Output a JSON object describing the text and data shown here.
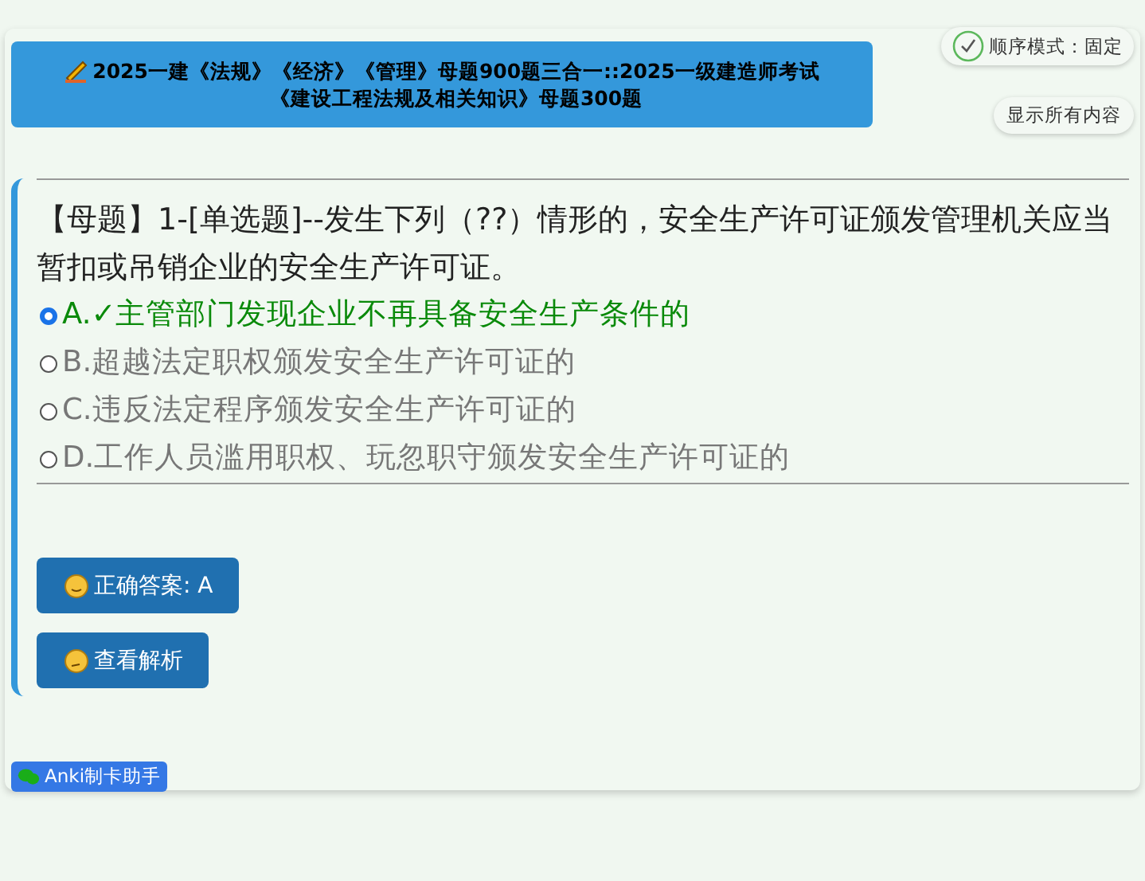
{
  "header": {
    "title_lines": [
      "2025一建《法规》《经济》《管理》母题900题三合一::2025一级建造师考试",
      "《建设工程法规及相关知识》母题300题"
    ]
  },
  "mode_badge": {
    "text": "顺序模式：固定",
    "checked": true
  },
  "show_all_button": "显示所有内容",
  "question": {
    "text": "【母题】1-[单选题]--发生下列（??）情形的，安全生产许可证颁发管理机关应当暂扣或吊销企业的安全生产许可证。",
    "options": [
      {
        "label": "A.",
        "mark": "✓",
        "text": "主管部门发现企业不再具备安全生产条件的",
        "selected": true,
        "correct": true
      },
      {
        "label": "B.",
        "text": "超越法定职权颁发安全生产许可证的",
        "selected": false,
        "correct": false
      },
      {
        "label": "C.",
        "text": "违反法定程序颁发安全生产许可证的",
        "selected": false,
        "correct": false
      },
      {
        "label": "D.",
        "text": "工作人员滥用职权、玩忽职守颁发安全生产许可证的",
        "selected": false,
        "correct": false
      }
    ]
  },
  "buttons": [
    {
      "label": "正确答案: A",
      "kind": "smile"
    },
    {
      "label": "查看解析",
      "kind": "think"
    }
  ],
  "footer_badge": "Anki制卡助手"
}
